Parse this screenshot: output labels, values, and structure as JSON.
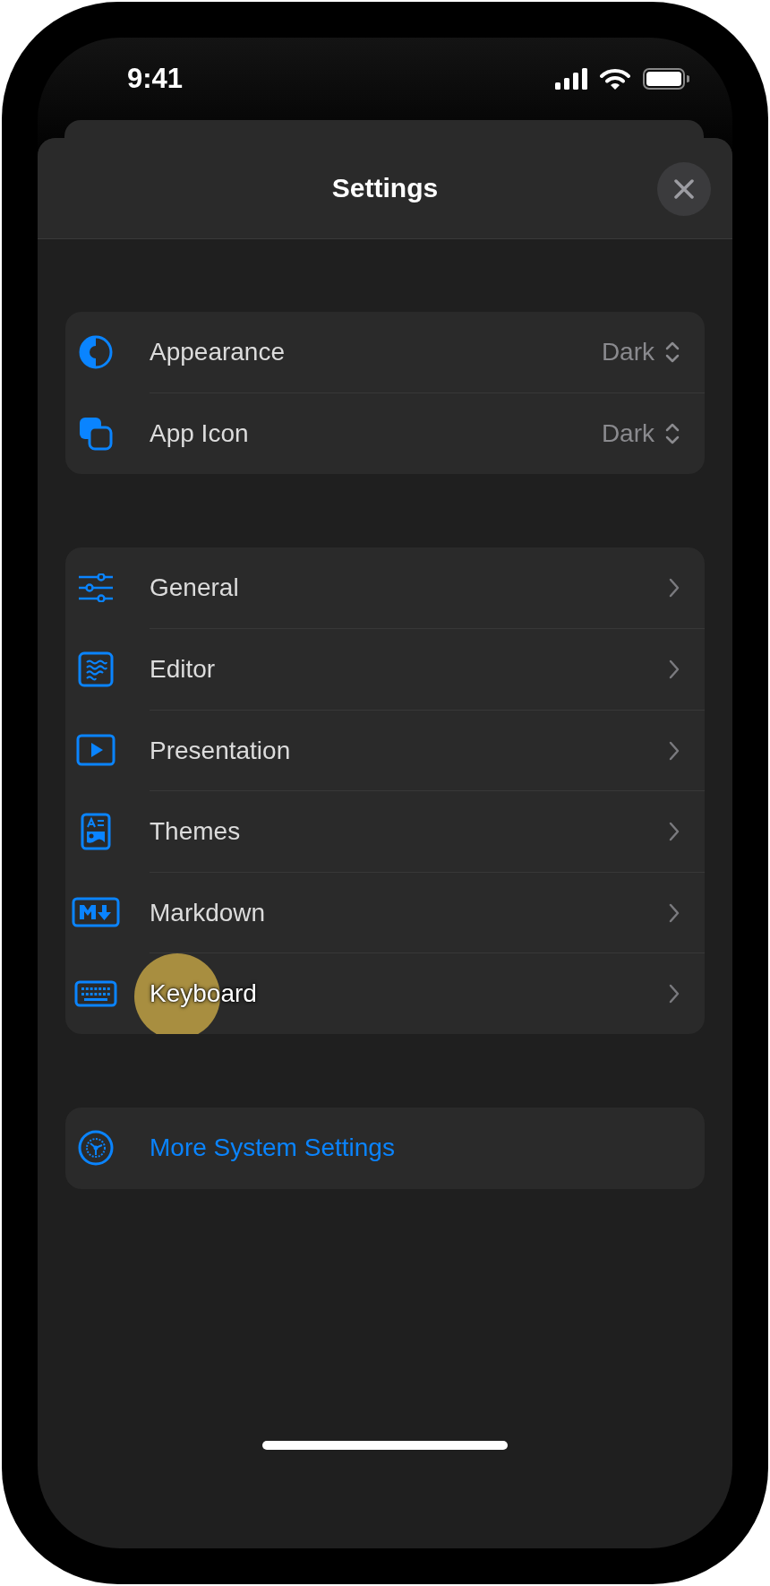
{
  "status_bar": {
    "time": "9:41"
  },
  "sheet": {
    "title": "Settings"
  },
  "groups": [
    {
      "rows": [
        {
          "kind": "picker",
          "label": "Appearance",
          "value": "Dark",
          "pressed": false
        },
        {
          "kind": "picker",
          "label": "App Icon",
          "value": "Dark",
          "pressed": false
        }
      ]
    },
    {
      "rows": [
        {
          "kind": "link",
          "label": "General",
          "pressed": false
        },
        {
          "kind": "link",
          "label": "Editor",
          "pressed": false
        },
        {
          "kind": "link",
          "label": "Presentation",
          "pressed": false
        },
        {
          "kind": "link",
          "label": "Themes",
          "pressed": false
        },
        {
          "kind": "link",
          "label": "Markdown",
          "pressed": false
        },
        {
          "kind": "link",
          "label": "Keyboard",
          "pressed": true
        }
      ]
    },
    {
      "rows": [
        {
          "kind": "action",
          "label": "More System Settings",
          "pressed": false
        }
      ]
    }
  ]
}
